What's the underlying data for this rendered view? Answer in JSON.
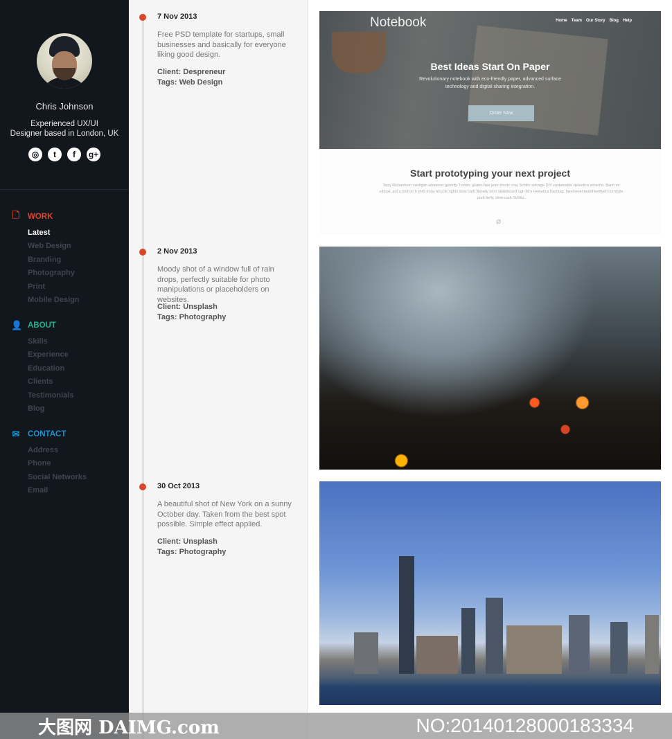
{
  "profile": {
    "name": "Chris Johnson",
    "bio_line1": "Experienced UX/UI",
    "bio_line2": "Designer based in London, UK",
    "social": [
      {
        "icon": "dribbble-icon",
        "glyph": "◎"
      },
      {
        "icon": "twitter-icon",
        "glyph": "t"
      },
      {
        "icon": "facebook-icon",
        "glyph": "f"
      },
      {
        "icon": "google-plus-icon",
        "glyph": "g+"
      }
    ]
  },
  "nav": [
    {
      "label": "WORK",
      "icon": "document-icon",
      "glyph": "🗋",
      "color": "#d9472b",
      "items": [
        "Latest",
        "Web Design",
        "Branding",
        "Photography",
        "Print",
        "Mobile Design"
      ],
      "active": 0
    },
    {
      "label": "ABOUT",
      "icon": "user-icon",
      "glyph": "👤",
      "color": "#1fb38a",
      "items": [
        "Skills",
        "Experience",
        "Education",
        "Clients",
        "Testimonials",
        "Blog"
      ],
      "active": -1
    },
    {
      "label": "CONTACT",
      "icon": "envelope-icon",
      "glyph": "✉",
      "color": "#1a93d1",
      "items": [
        "Address",
        "Phone",
        "Social Networks",
        "Email"
      ],
      "active": -1
    }
  ],
  "posts": [
    {
      "date": "7 Nov 2013",
      "desc": "Free PSD template for startups, small businesses and basically for everyone liking good design.",
      "client": "Client: Despreneur",
      "tags": "Tags: Web Design"
    },
    {
      "date": "2 Nov 2013",
      "desc": "Moody shot of a window full of rain drops, perfectly suitable for photo manipulations or placeholders on websites.",
      "client": "Client: Unsplash",
      "tags": "Tags: Photography"
    },
    {
      "date": "30 Oct 2013",
      "desc": "A beautiful shot of New York on a sunny October day. Taken from the best spot possible. Simple effect applied.",
      "client": "Client: Unsplash",
      "tags": "Tags: Photography"
    }
  ],
  "preview": {
    "logo": "Notebook",
    "links": [
      "Home",
      "Team",
      "Our Story",
      "Blog",
      "Help"
    ],
    "headline": "Best Ideas Start On Paper",
    "subline": "Revolutionary notebook with eco-friendly paper, advanced surface technology and digital sharing integration.",
    "button": "Order Now",
    "section_title": "Start prototyping your next project",
    "section_text": "Terry Richardson cardigan whatever gentrify Tumblr, gluten-free jean shorts cray Schlitz selvage DIY sustainable Helvetica sriracha. Banh mi ethical, put a bird on it VHS irony bicycle rights slow-carb literally retro skateboard ugh 90's Helvetica hashtag. Next level beard keffiyeh cornhole pork belly, slow-carb Schlitz."
  },
  "watermark": {
    "left": "大图网 DAIMG.com",
    "right": "NO:20140128000183334"
  },
  "colors": {
    "sidebar": "#12161d",
    "accent": "#d9472b"
  }
}
